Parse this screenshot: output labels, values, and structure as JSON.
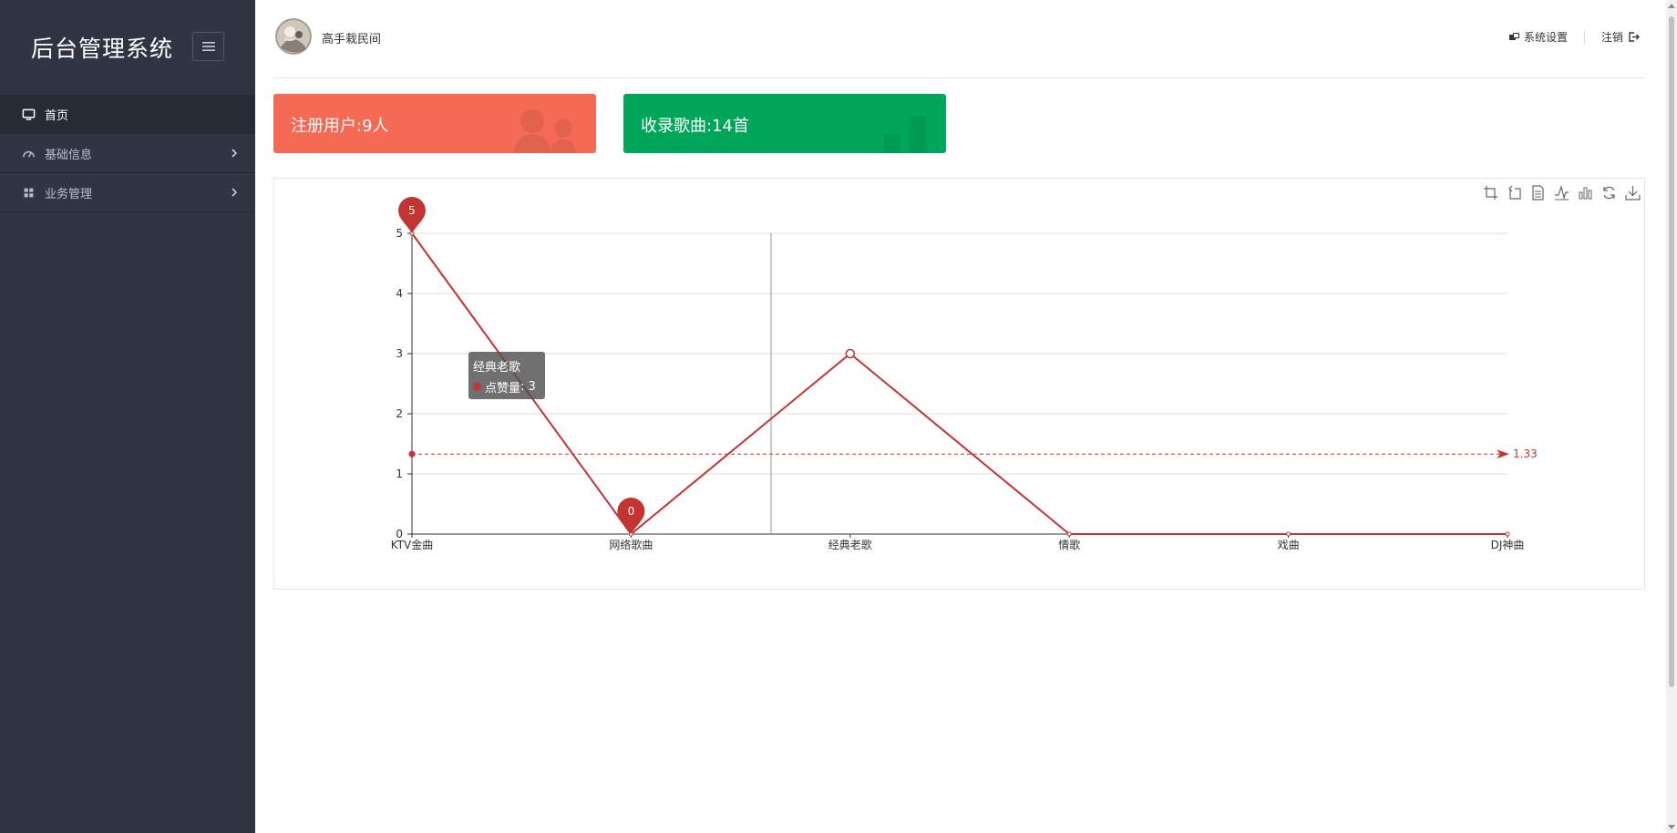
{
  "sidebar": {
    "brand": "后台管理系统",
    "items": [
      {
        "label": "首页",
        "icon": "monitor-icon",
        "active": true
      },
      {
        "label": "基础信息",
        "icon": "dashboard-gauge-icon"
      },
      {
        "label": "业务管理",
        "icon": "grid-icon"
      }
    ]
  },
  "header": {
    "username": "高手栽民间",
    "settings_label": "系统设置",
    "logout_label": "注销"
  },
  "cards": {
    "users": "注册用户:9人",
    "songs": "收录歌曲:14首"
  },
  "colors": {
    "sidebar_bg": "#2f3542",
    "card_users": "#f46a52",
    "card_songs": "#00a65a",
    "series": "#c23531"
  },
  "chart_data": {
    "type": "line",
    "categories": [
      "KTV金曲",
      "网络歌曲",
      "经典老歌",
      "情歌",
      "戏曲",
      "DJ神曲"
    ],
    "series": [
      {
        "name": "点赞量",
        "values": [
          5,
          0,
          3,
          0,
          0,
          0
        ]
      }
    ],
    "ylim": [
      0,
      5
    ],
    "yticks": [
      0,
      1,
      2,
      3,
      4,
      5
    ],
    "mark_points": [
      {
        "label": "5",
        "index": 0
      },
      {
        "label": "0",
        "index": 1
      }
    ],
    "mark_line": {
      "value": 1.33,
      "label": "1.33"
    },
    "grid": "horizontal",
    "tooltip": {
      "title": "经典老歌",
      "series": "点赞量",
      "value": "3"
    }
  }
}
